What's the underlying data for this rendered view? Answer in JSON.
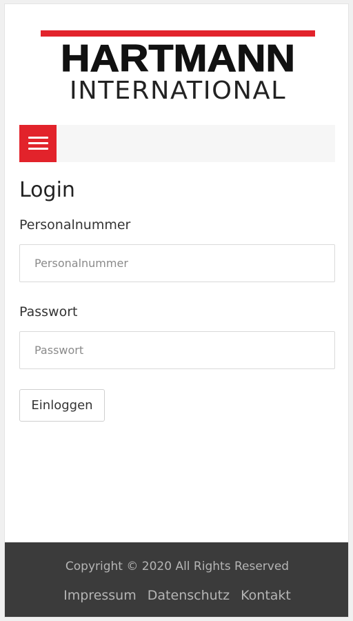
{
  "brand": {
    "logo_line1": "HARTMANN",
    "logo_line2": "INTERNATIONAL",
    "accent_color": "#e2232b"
  },
  "nav": {
    "menu_icon": "hamburger-menu-icon"
  },
  "login": {
    "title": "Login",
    "personalnummer": {
      "label": "Personalnummer",
      "placeholder": "Personalnummer",
      "value": ""
    },
    "passwort": {
      "label": "Passwort",
      "placeholder": "Passwort",
      "value": ""
    },
    "submit_label": "Einloggen"
  },
  "footer": {
    "copyright": "Copyright © 2020 All Rights Reserved",
    "links": [
      "Impressum",
      "Datenschutz",
      "Kontakt"
    ],
    "background_color": "#3b3b3b"
  }
}
